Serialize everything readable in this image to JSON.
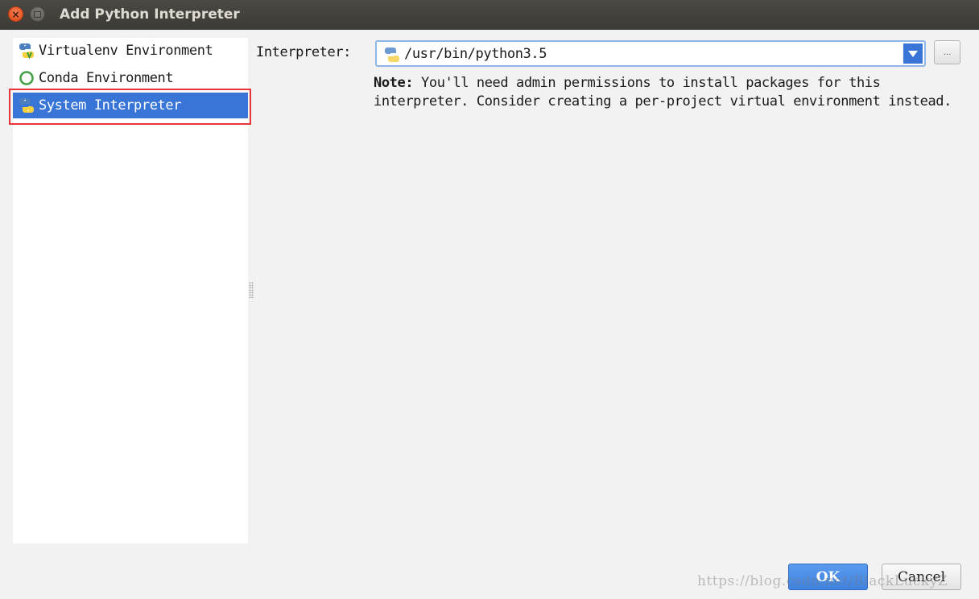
{
  "window": {
    "title": "Add Python Interpreter",
    "close_glyph": "×"
  },
  "sidebar": {
    "items": [
      {
        "label": "Virtualenv Environment",
        "icon": "python-virtualenv-icon"
      },
      {
        "label": "Conda Environment",
        "icon": "conda-ring-icon"
      },
      {
        "label": "System Interpreter",
        "icon": "python-icon",
        "selected": true
      }
    ]
  },
  "interpreter": {
    "label": "Interpreter:",
    "value": "/usr/bin/python3.5",
    "browse_label": "..."
  },
  "note": {
    "heading": "Note:",
    "text": " You'll need admin permissions to install packages for this interpreter. Consider creating a per-project virtual environment instead."
  },
  "buttons": {
    "ok": "OK",
    "cancel": "Cancel"
  },
  "watermark": "https://blog.csdn.net/BlackLuckyZ",
  "colors": {
    "selection": "#3875d7",
    "highlight_outline": "#e8343b",
    "ok_button": "#4a8ee6"
  }
}
